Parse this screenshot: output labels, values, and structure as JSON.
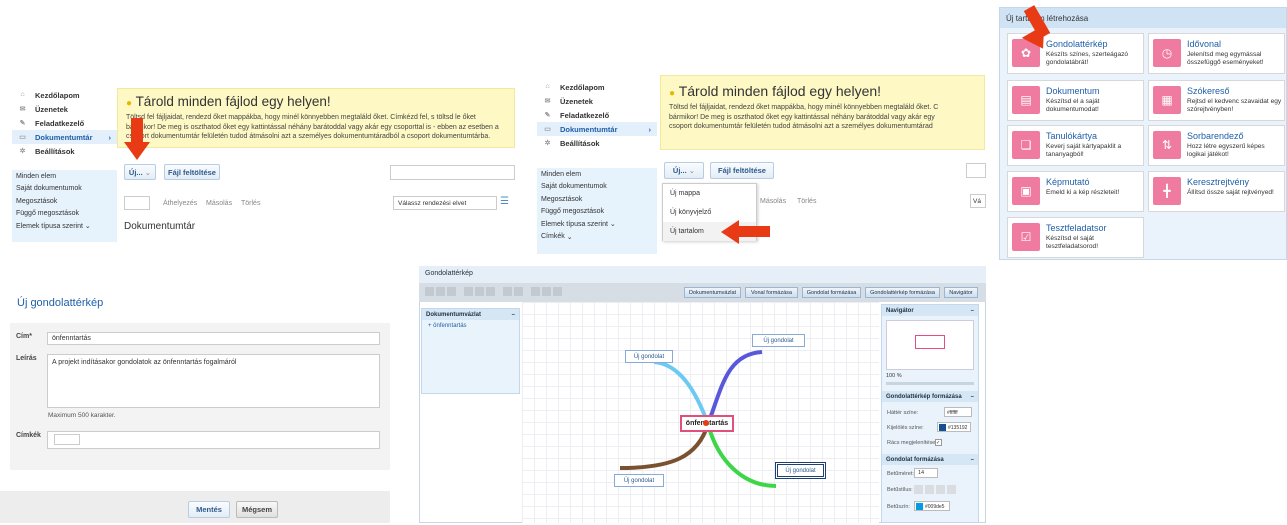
{
  "nav": {
    "items": [
      {
        "label": "Kezdőlapom",
        "icon": "home-icon"
      },
      {
        "label": "Üzenetek",
        "icon": "mail-icon"
      },
      {
        "label": "Feladatkezelő",
        "icon": "task-icon"
      },
      {
        "label": "Dokumentumtár",
        "icon": "folder-icon"
      },
      {
        "label": "Beállítások",
        "icon": "gear-icon"
      }
    ],
    "sub_items": [
      "Minden elem",
      "Saját dokumentumok",
      "Megosztások",
      "Függő megosztások",
      "Elemek típusa szerint",
      "Címkék"
    ]
  },
  "banner": {
    "title": "Tárold minden fájlod egy helyen!",
    "text1a": "Töltsd fel fájljaidat, rendezd őket mappákba, hogy minél könnyebben megtaláld őket. Címkézd fel, s töltsd le őket",
    "text1b": "bármikor! De meg is oszthatod őket egy kattintással néhány barátoddal vagy akár egy csoporttal is - ebben az esetben a",
    "text1c": "csoport dokumentumtár felületén tudod átmásolni azt a személyes dokumentumtáradból a csoport dokumentumtárba.",
    "text2a": "Töltsd fel fájljaidat, rendezd őket mappákba, hogy minél könnyebben megtaláld őket. C",
    "text2b": "bármikor! De meg is oszthatod őket egy kattintással néhány barátoddal vagy akár egy",
    "text2c": "csoport dokumentumtár felületén tudod átmásolni azt a személyes dokumentumtárad"
  },
  "toolbar": {
    "new_label": "Új...",
    "upload_label": "Fájl feltöltése",
    "move_label": "Áthelyezés",
    "copy_label": "Másolás",
    "delete_label": "Törlés",
    "sort_placeholder": "Válassz rendezési elvet",
    "sort_short": "Vá"
  },
  "doc_heading": "Dokumentumtár",
  "new_menu": [
    "Új mappa",
    "Új könyvjelző",
    "Új tartalom"
  ],
  "create": {
    "header": "Új tartalom létrehozása",
    "tiles": [
      {
        "title": "Gondolattérkép",
        "desc": "Készíts színes, szerteágazó gondolatábrát!",
        "icon": "mindmap-icon"
      },
      {
        "title": "Idővonal",
        "desc": "Jelenítsd meg egymással összefüggő eseményeket!",
        "icon": "clock-icon"
      },
      {
        "title": "Dokumentum",
        "desc": "Készítsd el a saját dokumentumodat!",
        "icon": "document-icon"
      },
      {
        "title": "Szókereső",
        "desc": "Rejtsd el kedvenc szavaidat egy szórejtvényben!",
        "icon": "wordsearch-icon"
      },
      {
        "title": "Tanulókártya",
        "desc": "Keverj saját kártyapaklit a tananyagból!",
        "icon": "cards-icon"
      },
      {
        "title": "Sorbarendező",
        "desc": "Hozz létre egyszerű képes logikai játékot!",
        "icon": "sort-icon"
      },
      {
        "title": "Képmutató",
        "desc": "Emeld ki a kép részleteit!",
        "icon": "image-icon"
      },
      {
        "title": "Keresztrejtvény",
        "desc": "Állítsd össze saját rejtvényed!",
        "icon": "crossword-icon"
      },
      {
        "title": "Tesztfeladatsor",
        "desc": "Készítsd el saját tesztfeladatsorod!",
        "icon": "test-icon"
      }
    ]
  },
  "form": {
    "heading": "Új gondolattérkép",
    "title_label": "Cím*",
    "title_value": "önfenntartás",
    "desc_label": "Leírás",
    "desc_value": "A projekt indításakor gondolatok az önfenntartás fogalmáról",
    "desc_hint": "Maximum 500 karakter.",
    "tags_label": "Címkék",
    "save": "Mentés",
    "cancel": "Mégsem"
  },
  "editor": {
    "title": "Gondolattérkép",
    "format_buttons": [
      "Dokumentumvázlat",
      "Vonal formázása",
      "Gondolat formázása",
      "Gondolattérkép formázása",
      "Navigátor"
    ],
    "outline_title": "Dokumentumvázlat",
    "outline_item": "önfenntartás",
    "center_node": "önfenntartás",
    "nodes": [
      "Új gondolat",
      "Új gondolat",
      "Új gondolat",
      "Új gondolat"
    ],
    "navigator_title": "Navigátor",
    "zoom": "100 %",
    "map_format_title": "Gondolattérkép formázása",
    "bg_color_label": "Háttér színe:",
    "bg_color_value": "#ffffff",
    "sel_color_label": "Kijelölés színe:",
    "sel_color_value": "#135192",
    "grid_label": "Rács megjelenítése:",
    "thought_format_title": "Gondolat formázása",
    "fontsize_label": "Betűméret:",
    "fontsize_value": "14",
    "fontstyle_label": "Betűstílus:",
    "fontcolor_label": "Betűszín:",
    "fontcolor_value": "#009de5"
  },
  "colors": {
    "accent": "#1f5fa8",
    "arrow": "#e83a14",
    "banner": "#fdf8c4",
    "tile_icon": "#f07ba0"
  }
}
